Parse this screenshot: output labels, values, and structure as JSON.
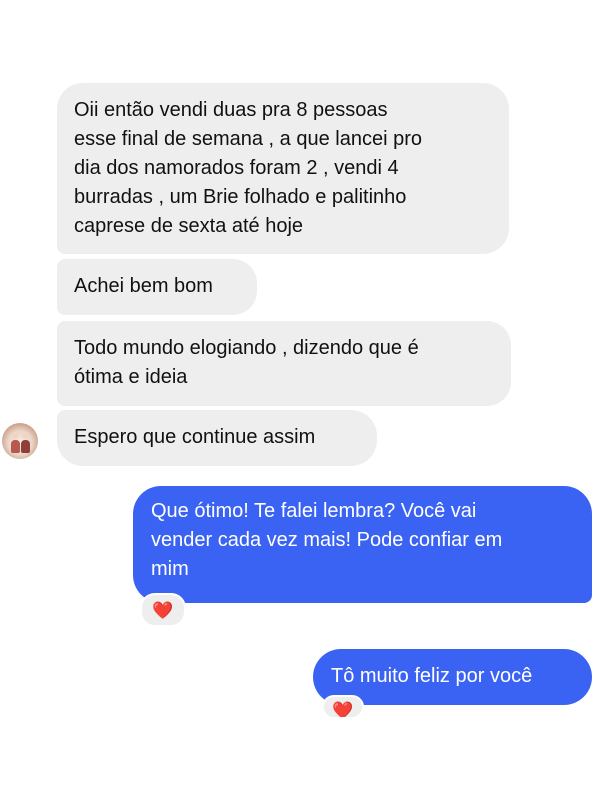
{
  "messages": {
    "incoming": [
      "Oii então vendi duas pra 8 pessoas\nesse final de semana , a que lancei pro\ndia dos namorados foram 2 , vendi 4\nburradas , um Brie folhado e palitinho\ncaprese de sexta até hoje",
      "Achei bem bom",
      "Todo mundo elogiando , dizendo que é\nótima e ideia",
      "Espero que continue assim"
    ],
    "outgoing": [
      "Que ótimo! Te falei lembra? Você vai\nvender cada vez mais! Pode confiar em\nmim",
      "Tô muito feliz por você"
    ]
  },
  "reactions": {
    "first": "❤️",
    "second": "❤️"
  },
  "colors": {
    "incoming_bubble": "#eeeeef",
    "outgoing_bubble": "#3b63f3",
    "heart": "#e0303d"
  },
  "icons": {
    "avatar": "contact-avatar",
    "reaction": "heart-icon"
  }
}
